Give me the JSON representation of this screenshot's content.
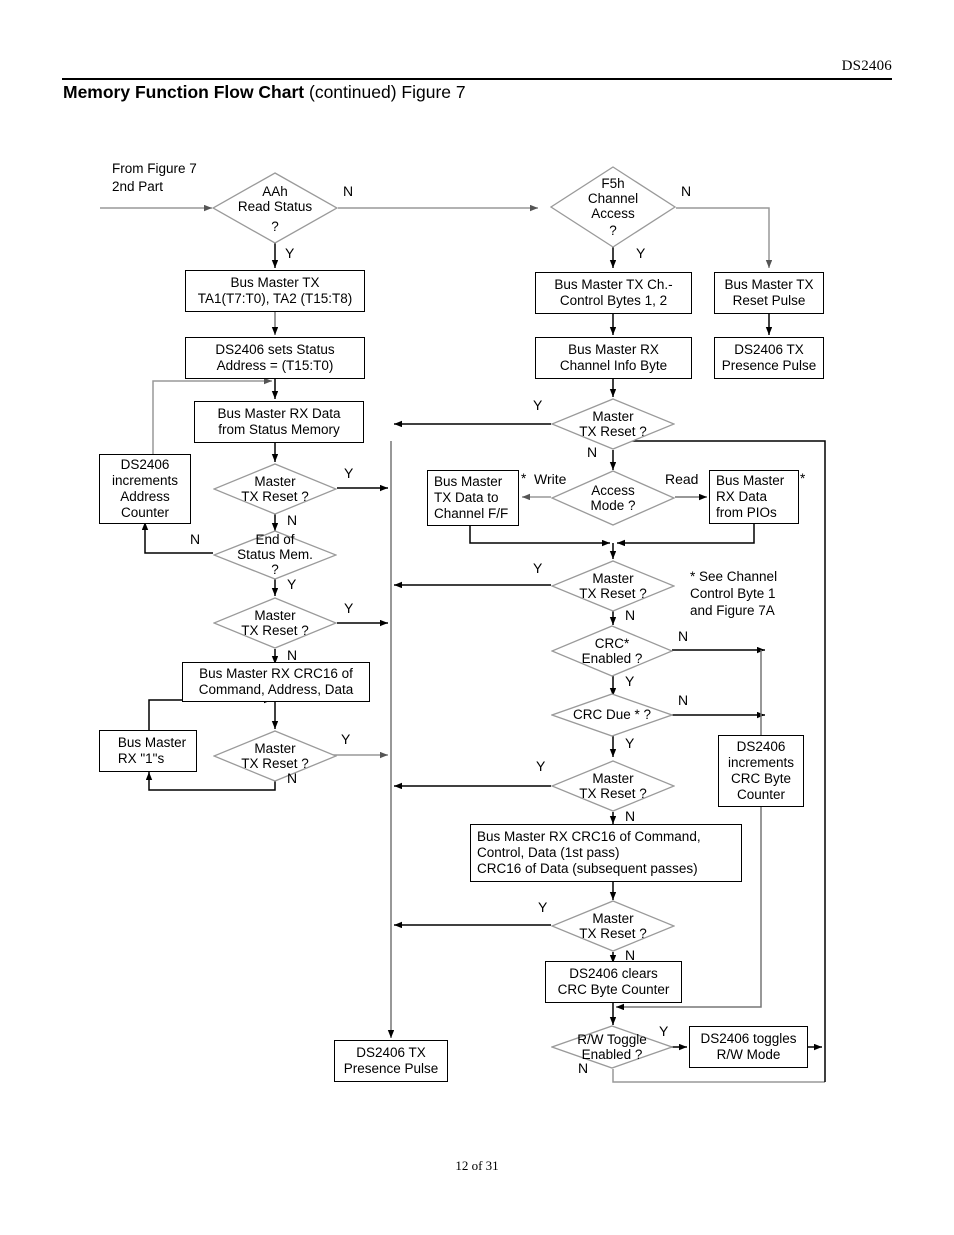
{
  "header": {
    "doc_id": "DS2406",
    "title_bold": "Memory Function Flow Chart",
    "title_rest": "(continued) Figure 7"
  },
  "footer": {
    "page": "12 of 31"
  },
  "entry": {
    "label_line1": "From Figure 7",
    "label_line2": "2nd Part"
  },
  "note": {
    "asterisk_note_l1": "* See Channel",
    "asterisk_note_l2": "Control Byte 1",
    "asterisk_note_l3": "and Figure 7A"
  },
  "branch_labels": {
    "yes": "Y",
    "no": "N",
    "write": "Write",
    "read": "Read",
    "star": "*",
    "question": "?"
  },
  "chart_data": {
    "type": "diagram",
    "title": "Memory Function Flow Chart (continued) Figure 7",
    "decisions": [
      {
        "id": "aah-read-status",
        "text": [
          "AAh",
          "Read Status",
          "?"
        ],
        "yes": "bus-master-tx-ta",
        "no": "f5h-channel-access"
      },
      {
        "id": "f5h-channel-access",
        "text": [
          "F5h",
          "Channel",
          "Access",
          "?"
        ],
        "yes": "bus-master-tx-ch-control",
        "no": "bus-master-tx-reset-pulse"
      },
      {
        "id": "master-tx-reset-1",
        "text": [
          "Master",
          "TX Reset ?"
        ],
        "yes": "right-rail",
        "no": "end-of-status-mem"
      },
      {
        "id": "end-of-status-mem",
        "text": [
          "End of",
          "Status Mem.",
          "?"
        ],
        "yes": "master-tx-reset-2",
        "no": "ds2406-increments-address-counter"
      },
      {
        "id": "master-tx-reset-2",
        "text": [
          "Master",
          "TX Reset ?"
        ],
        "yes": "right-rail",
        "no": "bus-master-rx-crc16-cad"
      },
      {
        "id": "master-tx-reset-3",
        "text": [
          "Master",
          "TX Reset ?"
        ],
        "yes": "right-rail",
        "no": "bus-master-rx-ones"
      },
      {
        "id": "master-tx-reset-ch",
        "text": [
          "Master",
          "TX Reset ?"
        ],
        "yes": "left-rail",
        "no": "access-mode"
      },
      {
        "id": "access-mode",
        "text": [
          "Access",
          "Mode ?"
        ],
        "write": "bus-master-tx-data-to-channel-ff",
        "read": "bus-master-rx-data-from-pios"
      },
      {
        "id": "master-tx-reset-4",
        "text": [
          "Master",
          "TX Reset ?"
        ],
        "yes": "left-rail",
        "no": "crc-enabled"
      },
      {
        "id": "crc-enabled",
        "text": [
          "CRC*",
          "Enabled ?"
        ],
        "yes": "crc-due",
        "no": "crc-rail"
      },
      {
        "id": "crc-due",
        "text": [
          "CRC Due *",
          "?"
        ],
        "yes": "master-tx-reset-5",
        "no": "crc-rail"
      },
      {
        "id": "master-tx-reset-5",
        "text": [
          "Master",
          "TX Reset ?"
        ],
        "yes": "left-rail",
        "no": "bus-master-rx-crc16-ccd"
      },
      {
        "id": "master-tx-reset-6",
        "text": [
          "Master",
          "TX Reset ?"
        ],
        "yes": "left-rail",
        "no": "ds2406-clears-crc-byte-counter"
      },
      {
        "id": "rw-toggle-enabled",
        "text": [
          "R/W Toggle",
          "Enabled ?"
        ],
        "yes": "ds2406-toggles-rw-mode",
        "no": "loop-back"
      }
    ],
    "processes": [
      {
        "id": "bus-master-tx-ta",
        "text": [
          "Bus Master TX",
          "TA1(T7:T0), TA2 (T15:T8)"
        ]
      },
      {
        "id": "ds2406-sets-status-address",
        "text": [
          "DS2406 sets Status",
          "Address = (T15:T0)"
        ]
      },
      {
        "id": "bus-master-rx-data-status-mem",
        "text": [
          "Bus Master RX Data",
          "from Status Memory"
        ]
      },
      {
        "id": "ds2406-increments-address-counter",
        "text": [
          "DS2406",
          "increments",
          "Address",
          "Counter"
        ]
      },
      {
        "id": "bus-master-rx-crc16-cad",
        "text": [
          "Bus Master RX CRC16 of",
          "Command, Address, Data"
        ]
      },
      {
        "id": "bus-master-rx-ones",
        "text": [
          "Bus Master",
          "RX \"1\"s"
        ]
      },
      {
        "id": "bus-master-tx-ch-control",
        "text": [
          "Bus Master TX Ch.-",
          "Control Bytes 1, 2"
        ]
      },
      {
        "id": "bus-master-rx-channel-info",
        "text": [
          "Bus Master RX",
          "Channel Info Byte"
        ]
      },
      {
        "id": "bus-master-tx-reset-pulse",
        "text": [
          "Bus Master TX",
          "Reset Pulse"
        ]
      },
      {
        "id": "ds2406-tx-presence-pulse-right",
        "text": [
          "DS2406 TX",
          "Presence Pulse"
        ]
      },
      {
        "id": "bus-master-tx-data-to-channel-ff",
        "text": [
          "Bus Master",
          "TX Data to",
          "Channel F/F"
        ]
      },
      {
        "id": "bus-master-rx-data-from-pios",
        "text": [
          "Bus Master",
          "RX Data",
          "from PIOs"
        ]
      },
      {
        "id": "ds2406-increments-crc-byte-counter",
        "text": [
          "DS2406",
          "increments",
          "CRC Byte",
          "Counter"
        ]
      },
      {
        "id": "bus-master-rx-crc16-ccd",
        "text": [
          "Bus Master RX CRC16 of Command,",
          "Control, Data (1st pass)",
          "CRC16 of Data (subsequent passes)"
        ]
      },
      {
        "id": "ds2406-clears-crc-byte-counter",
        "text": [
          "DS2406 clears",
          "CRC Byte Counter"
        ]
      },
      {
        "id": "ds2406-toggles-rw-mode",
        "text": [
          "DS2406 toggles",
          "R/W Mode"
        ]
      },
      {
        "id": "ds2406-tx-presence-pulse-left",
        "text": [
          "DS2406 TX",
          "Presence Pulse"
        ]
      }
    ]
  },
  "nodes": {
    "aah_read_status": {
      "l1": "AAh",
      "l2": "Read Status",
      "l3": "?"
    },
    "f5h_channel": {
      "l1": "F5h",
      "l2": "Channel",
      "l3": "Access",
      "l4": "?"
    },
    "bm_tx_ta": {
      "l1": "Bus Master TX",
      "l2": "TA1(T7:T0), TA2 (T15:T8)"
    },
    "ds_sets_status": {
      "l1": "DS2406 sets Status",
      "l2": "Address = (T15:T0)"
    },
    "bm_rx_status_mem": {
      "l1": "Bus Master RX Data",
      "l2": "from Status Memory"
    },
    "ds_inc_addr": {
      "l1": "DS2406",
      "l2": "increments",
      "l3": "Address",
      "l4": "Counter"
    },
    "mtr1": {
      "l1": "Master",
      "l2": "TX Reset ?"
    },
    "end_status_mem": {
      "l1": "End of",
      "l2": "Status Mem.",
      "l3": "?"
    },
    "mtr2": {
      "l1": "Master",
      "l2": "TX Reset ?"
    },
    "bm_rx_crc_cad": {
      "l1": "Bus Master RX CRC16 of",
      "l2": "Command, Address, Data"
    },
    "bm_rx_ones": {
      "l1": "Bus Master",
      "l2": "RX \"1\"s"
    },
    "mtr3": {
      "l1": "Master",
      "l2": "TX Reset ?"
    },
    "bm_tx_ch_ctl": {
      "l1": "Bus Master TX Ch.-",
      "l2": "Control Bytes 1, 2"
    },
    "bm_rx_ch_info": {
      "l1": "Bus Master RX",
      "l2": "Channel Info Byte"
    },
    "bm_tx_reset_pulse": {
      "l1": "Bus Master TX",
      "l2": "Reset Pulse"
    },
    "ds_tx_pres_right": {
      "l1": "DS2406 TX",
      "l2": "Presence Pulse"
    },
    "mtr_ch": {
      "l1": "Master",
      "l2": "TX Reset ?"
    },
    "bm_tx_data_ff": {
      "l1": "Bus Master",
      "l2": "TX Data to",
      "l3": "Channel F/F"
    },
    "access_mode": {
      "l1": "Access",
      "l2": "Mode ?"
    },
    "bm_rx_pios": {
      "l1": "Bus Master",
      "l2": "RX Data",
      "l3": "from PIOs"
    },
    "mtr4": {
      "l1": "Master",
      "l2": "TX Reset ?"
    },
    "crc_enabled": {
      "l1": "CRC*",
      "l2": "Enabled ?"
    },
    "crc_due": {
      "l1": "CRC Due *   ?"
    },
    "mtr5": {
      "l1": "Master",
      "l2": "TX Reset ?"
    },
    "ds_inc_crc": {
      "l1": "DS2406",
      "l2": "increments",
      "l3": "CRC Byte",
      "l4": "Counter"
    },
    "bm_rx_crc_ccd": {
      "l1": "Bus Master RX CRC16 of Command,",
      "l2": "Control, Data (1st pass)",
      "l3": "CRC16 of Data (subsequent passes)"
    },
    "mtr6": {
      "l1": "Master",
      "l2": "TX Reset ?"
    },
    "ds_clears_crc": {
      "l1": "DS2406 clears",
      "l2": "CRC Byte Counter"
    },
    "rw_toggle": {
      "l1": "R/W Toggle",
      "l2": "Enabled ?"
    },
    "ds_toggles_rw": {
      "l1": "DS2406 toggles",
      "l2": "R/W Mode"
    },
    "ds_tx_pres_left": {
      "l1": "DS2406 TX",
      "l2": "Presence Pulse"
    }
  },
  "colors": {
    "line": "#000000",
    "grayline": "#808080",
    "text": "#000000",
    "background": "#ffffff"
  }
}
